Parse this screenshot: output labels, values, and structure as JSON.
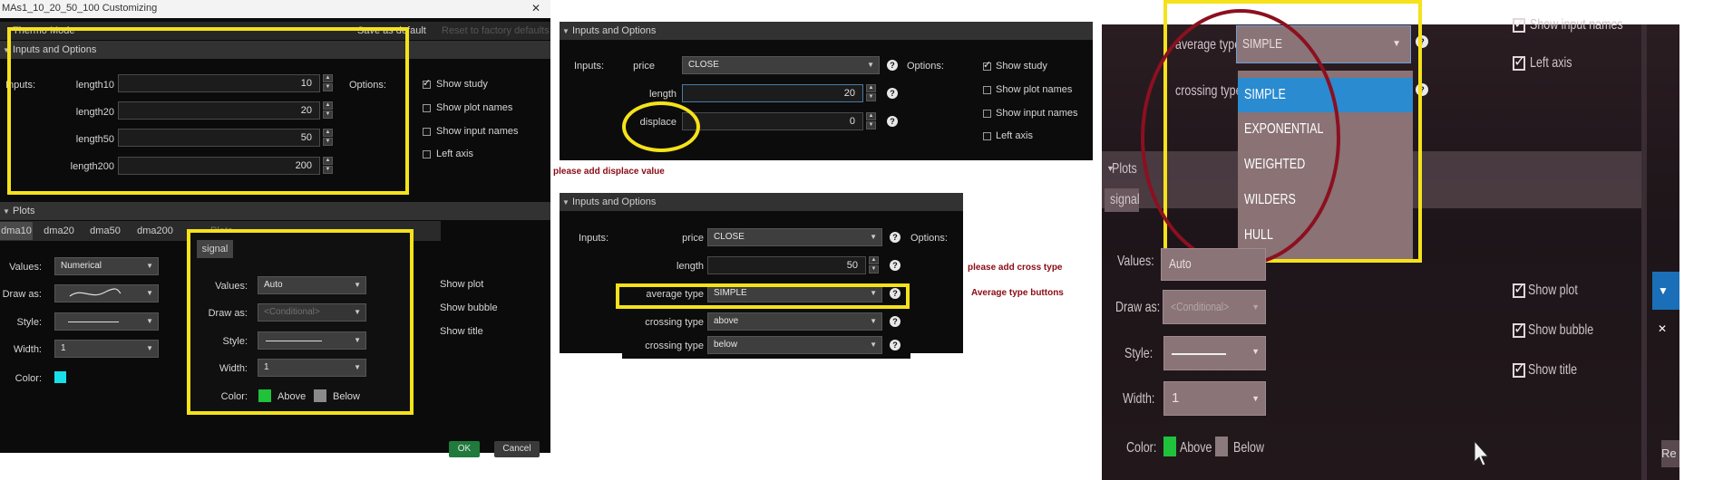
{
  "panel1": {
    "window_title": "MAs1_10_20_50_100 Customizing",
    "close_glyph": "✕",
    "toolbar": {
      "mode": "Thermo Mode",
      "save_default": "Save as default",
      "reset": "Reset to factory defaults"
    },
    "inputs_header": "Inputs and Options",
    "inputs_label": "Inputs:",
    "options_label": "Options:",
    "inputs": [
      {
        "name": "length10",
        "value": "10"
      },
      {
        "name": "length20",
        "value": "20"
      },
      {
        "name": "length50",
        "value": "50"
      },
      {
        "name": "length200",
        "value": "200"
      }
    ],
    "options": [
      {
        "label": "Show study",
        "checked": true
      },
      {
        "label": "Show plot names",
        "checked": false
      },
      {
        "label": "Show input names",
        "checked": false
      },
      {
        "label": "Left axis",
        "checked": false
      }
    ],
    "plots_header": "Plots",
    "plot_tabs": [
      "dma10",
      "dma20",
      "dma50",
      "dma200"
    ],
    "hidden_tab": "Plots",
    "plot_fields": {
      "values_label": "Values:",
      "values": "Numerical",
      "draw_label": "Draw as:",
      "style_label": "Style:",
      "width_label": "Width:",
      "width": "1",
      "color_label": "Color:"
    },
    "plot_color": "#18e0e8",
    "right_checks": [
      "Show plot",
      "Show bubble",
      "Show title"
    ],
    "ok": "OK",
    "cancel": "Cancel",
    "signal_popup": {
      "tab": "signal",
      "values_label": "Values:",
      "values": "Auto",
      "draw_label": "Draw as:",
      "draw": "<Conditional>",
      "style_label": "Style:",
      "width_label": "Width:",
      "width": "1",
      "color_label": "Color:",
      "above": "Above",
      "below": "Below",
      "above_color": "#1fc23a",
      "below_color": "#8a8a8a"
    }
  },
  "panel2": {
    "header": "Inputs and Options",
    "inputs_label": "Inputs:",
    "options_label": "Options:",
    "price_label": "price",
    "price": "CLOSE",
    "length_label": "length",
    "length": "20",
    "displace_label": "displace",
    "displace": "0",
    "options": [
      {
        "label": "Show study",
        "checked": true
      },
      {
        "label": "Show plot names",
        "checked": false
      },
      {
        "label": "Show input names",
        "checked": false
      },
      {
        "label": "Left axis",
        "checked": false
      }
    ]
  },
  "note_displace": "please add displace value",
  "panel3": {
    "header": "Inputs and Options",
    "inputs_label": "Inputs:",
    "options_label": "Options:",
    "price_label": "price",
    "price": "CLOSE",
    "length_label": "length",
    "length": "50",
    "avg_label": "average type",
    "avg": "SIMPLE",
    "cross1_label": "crossing type",
    "cross1": "above",
    "cross2_label": "crossing type",
    "cross2": "below"
  },
  "note_cross": "please add cross  type",
  "note_avg": "Average type buttons",
  "photo": {
    "top_options": [
      "Show input names",
      "Left axis"
    ],
    "avg_label": "average type",
    "avg_value": "SIMPLE",
    "cross_label": "crossing type",
    "dropdown": [
      "SIMPLE",
      "EXPONENTIAL",
      "WEIGHTED",
      "WILDERS",
      "HULL"
    ],
    "plots": "Plots",
    "signal": "signal",
    "values_label": "Values:",
    "values": "Auto",
    "draw_label": "Draw as:",
    "draw": "<Conditional>",
    "style_label": "Style:",
    "width_label": "Width:",
    "width": "1",
    "color_label": "Color:",
    "above": "Above",
    "below": "Below",
    "checks": [
      "Show plot",
      "Show bubble",
      "Show title"
    ],
    "btn_fragment": "Re"
  },
  "colors": {
    "highlight": "#f5e21a",
    "annotation": "#8b0a14",
    "ok_green": "#1f7a3c"
  }
}
